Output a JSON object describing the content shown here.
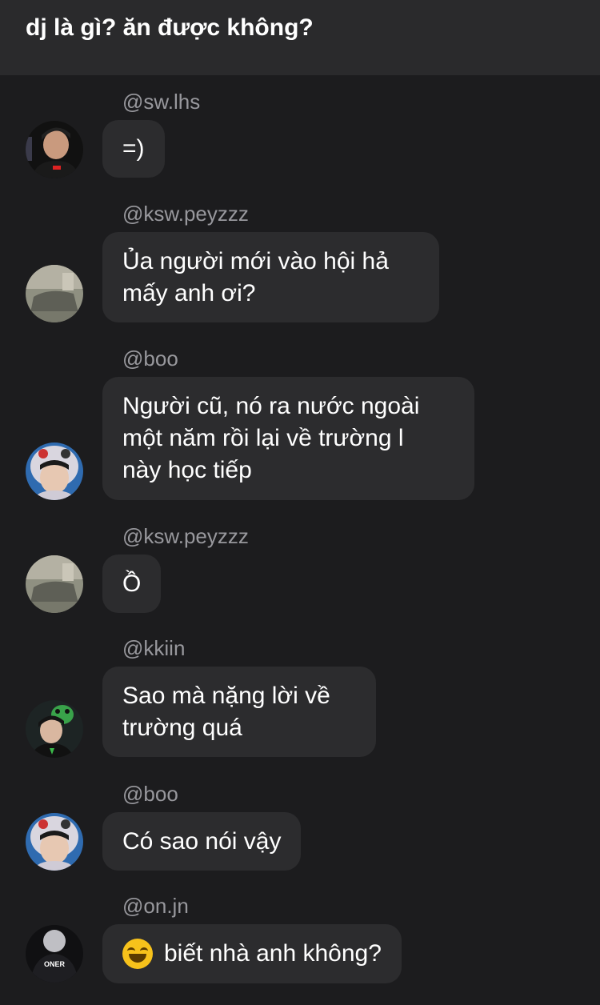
{
  "header": {
    "title": "dj là gì? ăn được không?"
  },
  "messages": [
    {
      "user": "@sw.lhs",
      "text": "=)",
      "avatar": "avatar-lhs-icon"
    },
    {
      "user": "@ksw.peyzzz",
      "text": "Ủa người mới vào hội hả\nmấy anh ơi?",
      "avatar": "avatar-peyzzz-icon"
    },
    {
      "user": "@boo",
      "text": "Người cũ, nó ra nước ngoài\nmột năm rồi lại về trường l\nnày học tiếp",
      "avatar": "avatar-boo-icon"
    },
    {
      "user": "@ksw.peyzzz",
      "text": "Ồ",
      "avatar": "avatar-peyzzz-icon"
    },
    {
      "user": "@kkiin",
      "text": "Sao mà nặng lời về\ntrường quá",
      "avatar": "avatar-kkiin-icon"
    },
    {
      "user": "@boo",
      "text": "Có sao nói vậy",
      "avatar": "avatar-boo-icon"
    },
    {
      "user": "@on.jn",
      "text": "biết nhà anh không?",
      "emoji": "grinning-squinting-face-icon",
      "avatar": "avatar-onjn-icon",
      "avatar_label": "ONER"
    }
  ]
}
